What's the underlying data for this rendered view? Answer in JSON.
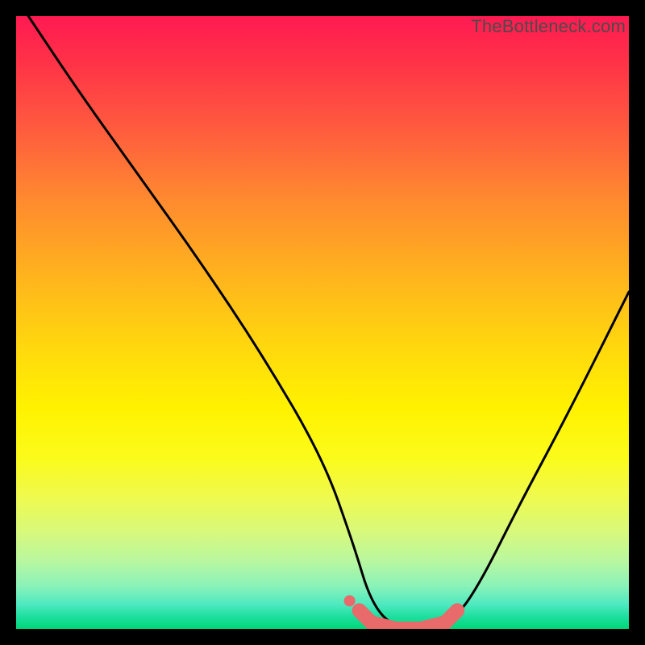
{
  "watermark": "TheBottleneck.com",
  "colors": {
    "frame": "#000000",
    "curve_stroke": "#000000",
    "marker_fill": "#e86a6a",
    "marker_stroke": "#d85c5c"
  },
  "chart_data": {
    "type": "line",
    "title": "",
    "xlabel": "",
    "ylabel": "",
    "xlim": [
      0,
      100
    ],
    "ylim": [
      0,
      100
    ],
    "grid": false,
    "legend": false,
    "series": [
      {
        "name": "bottleneck-curve",
        "x": [
          2,
          10,
          20,
          30,
          40,
          50,
          55,
          58,
          62,
          68,
          72,
          76,
          82,
          90,
          100
        ],
        "values": [
          100,
          88,
          74,
          60,
          45,
          28,
          14,
          4,
          0,
          0,
          2,
          8,
          20,
          35,
          55
        ]
      }
    ],
    "markers": {
      "name": "optimal-range",
      "x": [
        56,
        58,
        60,
        62,
        64,
        66,
        68,
        70,
        72
      ],
      "values": [
        3,
        1,
        0.5,
        0,
        0,
        0,
        0.5,
        1,
        3
      ]
    }
  }
}
